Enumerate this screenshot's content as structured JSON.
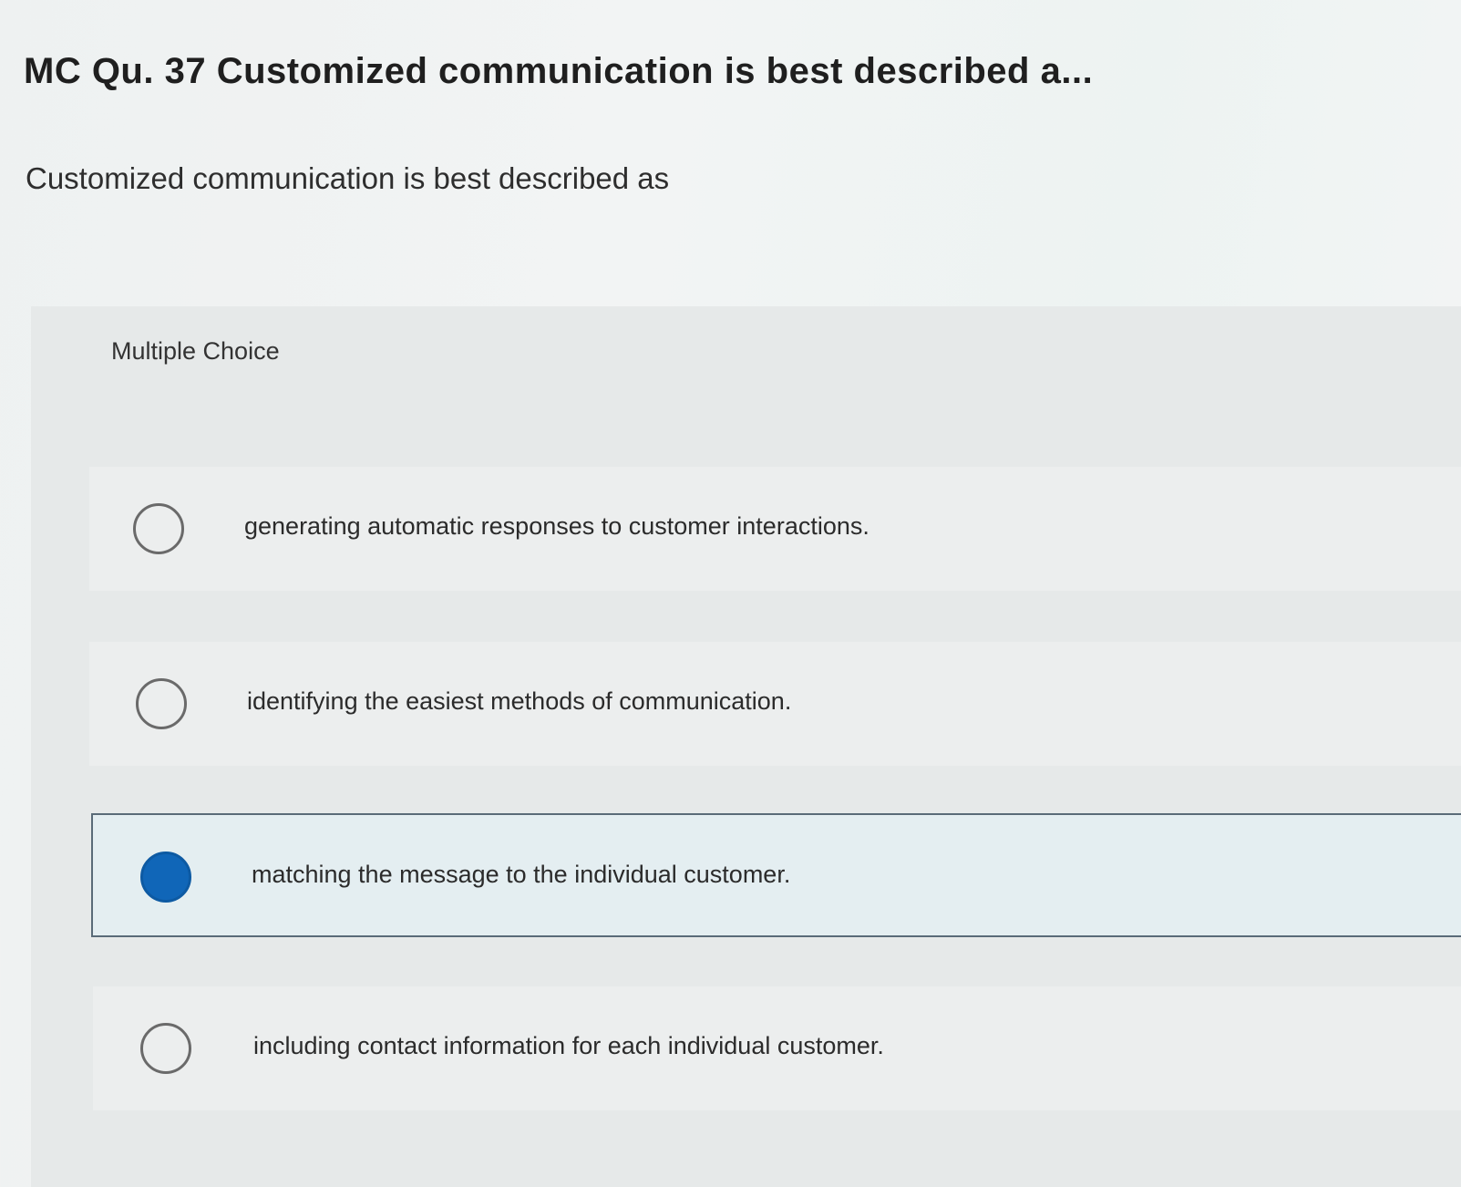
{
  "question": {
    "title": "MC Qu. 37 Customized communication is best described a...",
    "text": "Customized communication is best described as"
  },
  "choices": {
    "heading": "Multiple Choice",
    "options": [
      {
        "label": "generating automatic responses to customer interactions.",
        "selected": false
      },
      {
        "label": "identifying the easiest methods of communication.",
        "selected": false
      },
      {
        "label": "matching the message to the individual customer.",
        "selected": true
      },
      {
        "label": "including contact information for each individual customer.",
        "selected": false
      }
    ],
    "selected_color": "#1066b8"
  }
}
